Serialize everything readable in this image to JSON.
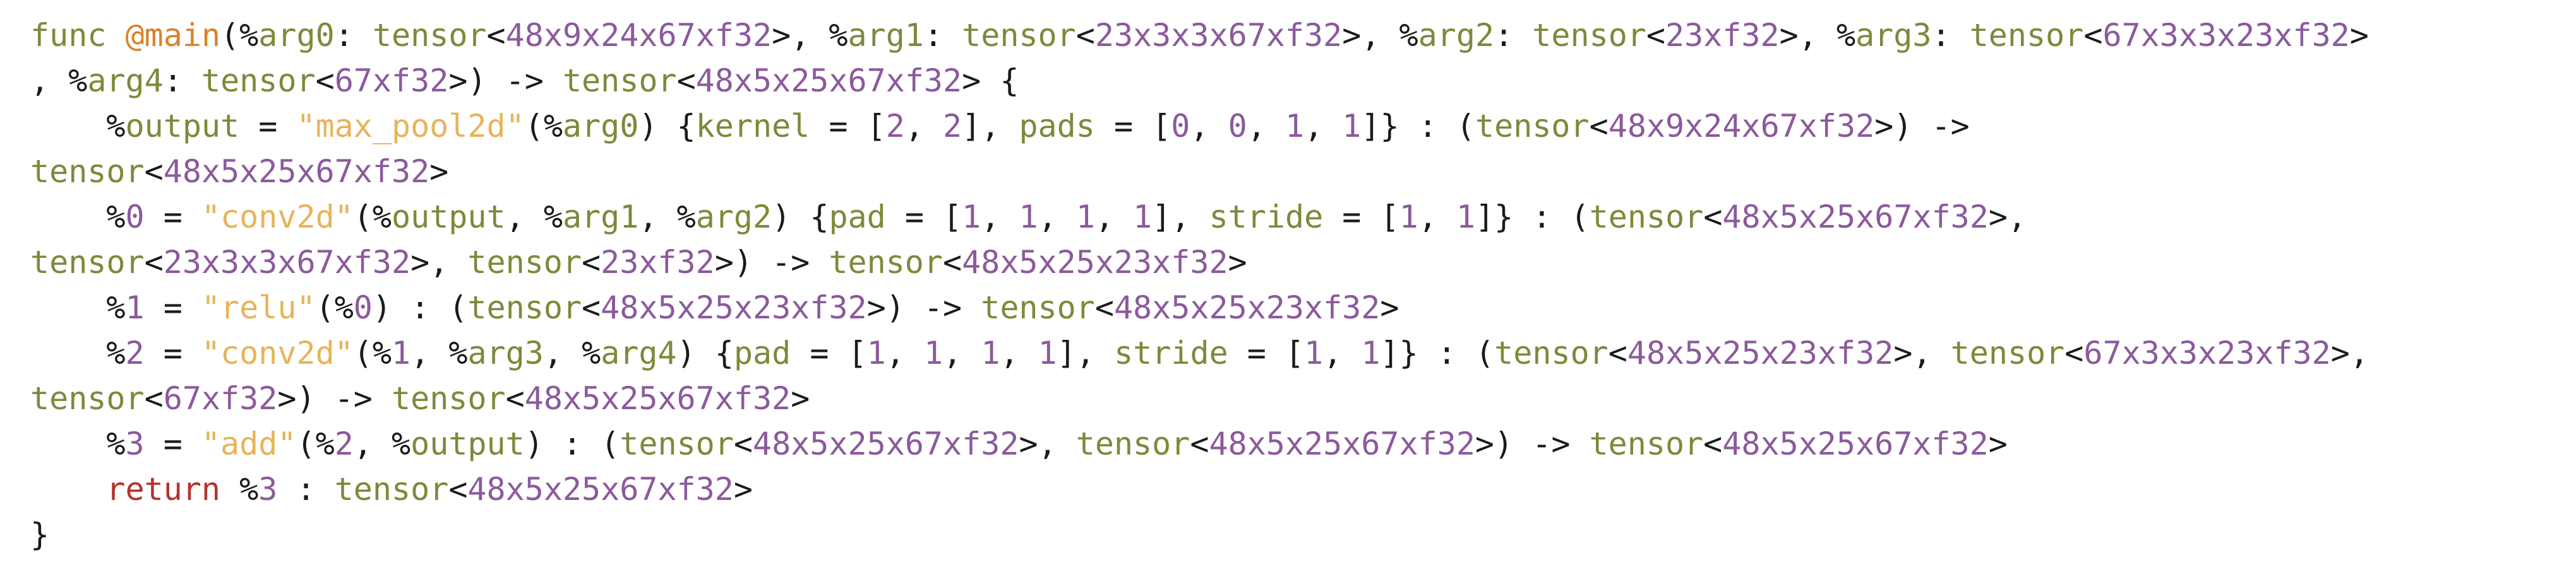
{
  "colors": {
    "background": "#ffffff",
    "keyword": "#7c8a3a",
    "function_name": "#d9822b",
    "type_name": "#7c8a3a",
    "number": "#8b5a9b",
    "variable": "#7c8a3a",
    "string": "#e8b45a",
    "return_keyword": "#b5332e",
    "punctuation": "#1a1a1a"
  },
  "code": {
    "lines": [
      [
        {
          "t": "func",
          "c": "kw"
        },
        {
          "t": " ",
          "c": "plain"
        },
        {
          "t": "@main",
          "c": "fn"
        },
        {
          "t": "(",
          "c": "punct"
        },
        {
          "t": "%",
          "c": "pct"
        },
        {
          "t": "arg0",
          "c": "var"
        },
        {
          "t": ": ",
          "c": "punct"
        },
        {
          "t": "tensor",
          "c": "type"
        },
        {
          "t": "<",
          "c": "punct"
        },
        {
          "t": "48x9x24x67xf32",
          "c": "num"
        },
        {
          "t": ">, ",
          "c": "punct"
        },
        {
          "t": "%",
          "c": "pct"
        },
        {
          "t": "arg1",
          "c": "var"
        },
        {
          "t": ": ",
          "c": "punct"
        },
        {
          "t": "tensor",
          "c": "type"
        },
        {
          "t": "<",
          "c": "punct"
        },
        {
          "t": "23x3x3x67xf32",
          "c": "num"
        },
        {
          "t": ">, ",
          "c": "punct"
        },
        {
          "t": "%",
          "c": "pct"
        },
        {
          "t": "arg2",
          "c": "var"
        },
        {
          "t": ": ",
          "c": "punct"
        },
        {
          "t": "tensor",
          "c": "type"
        },
        {
          "t": "<",
          "c": "punct"
        },
        {
          "t": "23xf32",
          "c": "num"
        },
        {
          "t": ">, ",
          "c": "punct"
        },
        {
          "t": "%",
          "c": "pct"
        },
        {
          "t": "arg3",
          "c": "var"
        },
        {
          "t": ": ",
          "c": "punct"
        },
        {
          "t": "tensor",
          "c": "type"
        },
        {
          "t": "<",
          "c": "punct"
        },
        {
          "t": "67x3x3x23xf32",
          "c": "num"
        },
        {
          "t": ">",
          "c": "punct"
        }
      ],
      [
        {
          "t": ", ",
          "c": "punct"
        },
        {
          "t": "%",
          "c": "pct"
        },
        {
          "t": "arg4",
          "c": "var"
        },
        {
          "t": ": ",
          "c": "punct"
        },
        {
          "t": "tensor",
          "c": "type"
        },
        {
          "t": "<",
          "c": "punct"
        },
        {
          "t": "67xf32",
          "c": "num"
        },
        {
          "t": ">) -> ",
          "c": "punct"
        },
        {
          "t": "tensor",
          "c": "type"
        },
        {
          "t": "<",
          "c": "punct"
        },
        {
          "t": "48x5x25x67xf32",
          "c": "num"
        },
        {
          "t": "> {",
          "c": "punct"
        }
      ],
      [
        {
          "t": "    ",
          "c": "plain"
        },
        {
          "t": "%",
          "c": "pct"
        },
        {
          "t": "output",
          "c": "var"
        },
        {
          "t": " = ",
          "c": "punct"
        },
        {
          "t": "\"max_pool2d\"",
          "c": "str"
        },
        {
          "t": "(",
          "c": "punct"
        },
        {
          "t": "%",
          "c": "pct"
        },
        {
          "t": "arg0",
          "c": "var"
        },
        {
          "t": ") {",
          "c": "punct"
        },
        {
          "t": "kernel",
          "c": "var"
        },
        {
          "t": " = [",
          "c": "punct"
        },
        {
          "t": "2",
          "c": "num"
        },
        {
          "t": ", ",
          "c": "punct"
        },
        {
          "t": "2",
          "c": "num"
        },
        {
          "t": "], ",
          "c": "punct"
        },
        {
          "t": "pads",
          "c": "var"
        },
        {
          "t": " = [",
          "c": "punct"
        },
        {
          "t": "0",
          "c": "num"
        },
        {
          "t": ", ",
          "c": "punct"
        },
        {
          "t": "0",
          "c": "num"
        },
        {
          "t": ", ",
          "c": "punct"
        },
        {
          "t": "1",
          "c": "num"
        },
        {
          "t": ", ",
          "c": "punct"
        },
        {
          "t": "1",
          "c": "num"
        },
        {
          "t": "]} : (",
          "c": "punct"
        },
        {
          "t": "tensor",
          "c": "type"
        },
        {
          "t": "<",
          "c": "punct"
        },
        {
          "t": "48x9x24x67xf32",
          "c": "num"
        },
        {
          "t": ">) ->",
          "c": "punct"
        }
      ],
      [
        {
          "t": "tensor",
          "c": "type"
        },
        {
          "t": "<",
          "c": "punct"
        },
        {
          "t": "48x5x25x67xf32",
          "c": "num"
        },
        {
          "t": ">",
          "c": "punct"
        }
      ],
      [
        {
          "t": "    ",
          "c": "plain"
        },
        {
          "t": "%",
          "c": "pct"
        },
        {
          "t": "0",
          "c": "num"
        },
        {
          "t": " = ",
          "c": "punct"
        },
        {
          "t": "\"conv2d\"",
          "c": "str"
        },
        {
          "t": "(",
          "c": "punct"
        },
        {
          "t": "%",
          "c": "pct"
        },
        {
          "t": "output",
          "c": "var"
        },
        {
          "t": ", ",
          "c": "punct"
        },
        {
          "t": "%",
          "c": "pct"
        },
        {
          "t": "arg1",
          "c": "var"
        },
        {
          "t": ", ",
          "c": "punct"
        },
        {
          "t": "%",
          "c": "pct"
        },
        {
          "t": "arg2",
          "c": "var"
        },
        {
          "t": ") {",
          "c": "punct"
        },
        {
          "t": "pad",
          "c": "var"
        },
        {
          "t": " = [",
          "c": "punct"
        },
        {
          "t": "1",
          "c": "num"
        },
        {
          "t": ", ",
          "c": "punct"
        },
        {
          "t": "1",
          "c": "num"
        },
        {
          "t": ", ",
          "c": "punct"
        },
        {
          "t": "1",
          "c": "num"
        },
        {
          "t": ", ",
          "c": "punct"
        },
        {
          "t": "1",
          "c": "num"
        },
        {
          "t": "], ",
          "c": "punct"
        },
        {
          "t": "stride",
          "c": "var"
        },
        {
          "t": " = [",
          "c": "punct"
        },
        {
          "t": "1",
          "c": "num"
        },
        {
          "t": ", ",
          "c": "punct"
        },
        {
          "t": "1",
          "c": "num"
        },
        {
          "t": "]} : (",
          "c": "punct"
        },
        {
          "t": "tensor",
          "c": "type"
        },
        {
          "t": "<",
          "c": "punct"
        },
        {
          "t": "48x5x25x67xf32",
          "c": "num"
        },
        {
          "t": ">,",
          "c": "punct"
        }
      ],
      [
        {
          "t": "tensor",
          "c": "type"
        },
        {
          "t": "<",
          "c": "punct"
        },
        {
          "t": "23x3x3x67xf32",
          "c": "num"
        },
        {
          "t": ">, ",
          "c": "punct"
        },
        {
          "t": "tensor",
          "c": "type"
        },
        {
          "t": "<",
          "c": "punct"
        },
        {
          "t": "23xf32",
          "c": "num"
        },
        {
          "t": ">) -> ",
          "c": "punct"
        },
        {
          "t": "tensor",
          "c": "type"
        },
        {
          "t": "<",
          "c": "punct"
        },
        {
          "t": "48x5x25x23xf32",
          "c": "num"
        },
        {
          "t": ">",
          "c": "punct"
        }
      ],
      [
        {
          "t": "    ",
          "c": "plain"
        },
        {
          "t": "%",
          "c": "pct"
        },
        {
          "t": "1",
          "c": "num"
        },
        {
          "t": " = ",
          "c": "punct"
        },
        {
          "t": "\"relu\"",
          "c": "str"
        },
        {
          "t": "(",
          "c": "punct"
        },
        {
          "t": "%",
          "c": "pct"
        },
        {
          "t": "0",
          "c": "num"
        },
        {
          "t": ") : (",
          "c": "punct"
        },
        {
          "t": "tensor",
          "c": "type"
        },
        {
          "t": "<",
          "c": "punct"
        },
        {
          "t": "48x5x25x23xf32",
          "c": "num"
        },
        {
          "t": ">) -> ",
          "c": "punct"
        },
        {
          "t": "tensor",
          "c": "type"
        },
        {
          "t": "<",
          "c": "punct"
        },
        {
          "t": "48x5x25x23xf32",
          "c": "num"
        },
        {
          "t": ">",
          "c": "punct"
        }
      ],
      [
        {
          "t": "    ",
          "c": "plain"
        },
        {
          "t": "%",
          "c": "pct"
        },
        {
          "t": "2",
          "c": "num"
        },
        {
          "t": " = ",
          "c": "punct"
        },
        {
          "t": "\"conv2d\"",
          "c": "str"
        },
        {
          "t": "(",
          "c": "punct"
        },
        {
          "t": "%",
          "c": "pct"
        },
        {
          "t": "1",
          "c": "num"
        },
        {
          "t": ", ",
          "c": "punct"
        },
        {
          "t": "%",
          "c": "pct"
        },
        {
          "t": "arg3",
          "c": "var"
        },
        {
          "t": ", ",
          "c": "punct"
        },
        {
          "t": "%",
          "c": "pct"
        },
        {
          "t": "arg4",
          "c": "var"
        },
        {
          "t": ") {",
          "c": "punct"
        },
        {
          "t": "pad",
          "c": "var"
        },
        {
          "t": " = [",
          "c": "punct"
        },
        {
          "t": "1",
          "c": "num"
        },
        {
          "t": ", ",
          "c": "punct"
        },
        {
          "t": "1",
          "c": "num"
        },
        {
          "t": ", ",
          "c": "punct"
        },
        {
          "t": "1",
          "c": "num"
        },
        {
          "t": ", ",
          "c": "punct"
        },
        {
          "t": "1",
          "c": "num"
        },
        {
          "t": "], ",
          "c": "punct"
        },
        {
          "t": "stride",
          "c": "var"
        },
        {
          "t": " = [",
          "c": "punct"
        },
        {
          "t": "1",
          "c": "num"
        },
        {
          "t": ", ",
          "c": "punct"
        },
        {
          "t": "1",
          "c": "num"
        },
        {
          "t": "]} : (",
          "c": "punct"
        },
        {
          "t": "tensor",
          "c": "type"
        },
        {
          "t": "<",
          "c": "punct"
        },
        {
          "t": "48x5x25x23xf32",
          "c": "num"
        },
        {
          "t": ">, ",
          "c": "punct"
        },
        {
          "t": "tensor",
          "c": "type"
        },
        {
          "t": "<",
          "c": "punct"
        },
        {
          "t": "67x3x3x23xf32",
          "c": "num"
        },
        {
          "t": ">,",
          "c": "punct"
        }
      ],
      [
        {
          "t": "tensor",
          "c": "type"
        },
        {
          "t": "<",
          "c": "punct"
        },
        {
          "t": "67xf32",
          "c": "num"
        },
        {
          "t": ">) -> ",
          "c": "punct"
        },
        {
          "t": "tensor",
          "c": "type"
        },
        {
          "t": "<",
          "c": "punct"
        },
        {
          "t": "48x5x25x67xf32",
          "c": "num"
        },
        {
          "t": ">",
          "c": "punct"
        }
      ],
      [
        {
          "t": "    ",
          "c": "plain"
        },
        {
          "t": "%",
          "c": "pct"
        },
        {
          "t": "3",
          "c": "num"
        },
        {
          "t": " = ",
          "c": "punct"
        },
        {
          "t": "\"add\"",
          "c": "str"
        },
        {
          "t": "(",
          "c": "punct"
        },
        {
          "t": "%",
          "c": "pct"
        },
        {
          "t": "2",
          "c": "num"
        },
        {
          "t": ", ",
          "c": "punct"
        },
        {
          "t": "%",
          "c": "pct"
        },
        {
          "t": "output",
          "c": "var"
        },
        {
          "t": ") : (",
          "c": "punct"
        },
        {
          "t": "tensor",
          "c": "type"
        },
        {
          "t": "<",
          "c": "punct"
        },
        {
          "t": "48x5x25x67xf32",
          "c": "num"
        },
        {
          "t": ">, ",
          "c": "punct"
        },
        {
          "t": "tensor",
          "c": "type"
        },
        {
          "t": "<",
          "c": "punct"
        },
        {
          "t": "48x5x25x67xf32",
          "c": "num"
        },
        {
          "t": ">) -> ",
          "c": "punct"
        },
        {
          "t": "tensor",
          "c": "type"
        },
        {
          "t": "<",
          "c": "punct"
        },
        {
          "t": "48x5x25x67xf32",
          "c": "num"
        },
        {
          "t": ">",
          "c": "punct"
        }
      ],
      [
        {
          "t": "    ",
          "c": "plain"
        },
        {
          "t": "return",
          "c": "ret"
        },
        {
          "t": " ",
          "c": "plain"
        },
        {
          "t": "%",
          "c": "pct"
        },
        {
          "t": "3",
          "c": "num"
        },
        {
          "t": " : ",
          "c": "punct"
        },
        {
          "t": "tensor",
          "c": "type"
        },
        {
          "t": "<",
          "c": "punct"
        },
        {
          "t": "48x5x25x67xf32",
          "c": "num"
        },
        {
          "t": ">",
          "c": "punct"
        }
      ],
      [
        {
          "t": "}",
          "c": "punct"
        }
      ]
    ]
  }
}
